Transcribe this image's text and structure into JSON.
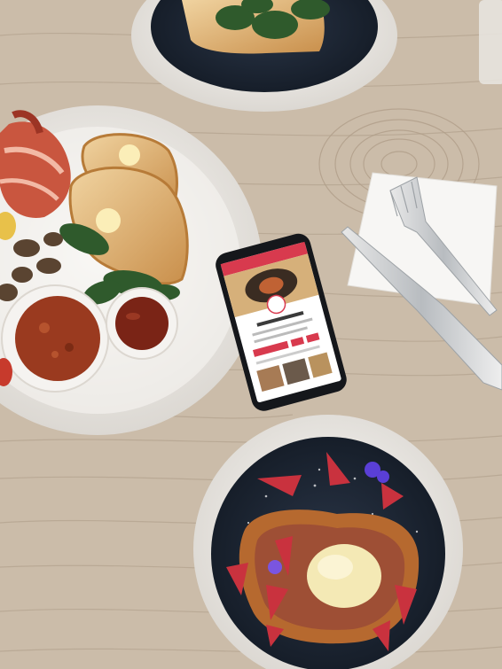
{
  "scene": {
    "description_label": "",
    "colors": {
      "table": "#cbbca9",
      "table_grain": "#b3a28e",
      "plate_white": "#f3f1ee",
      "plate_rim_dark": "#1f2a3a",
      "phone_accent": "#d83a4e",
      "bread": "#e1b77a",
      "spinach": "#2f5a2c",
      "beans": "#9a3a1f",
      "berry": "#c9323e"
    }
  },
  "phone": {
    "app_header": "",
    "listing_title": "",
    "cta_label": ""
  }
}
